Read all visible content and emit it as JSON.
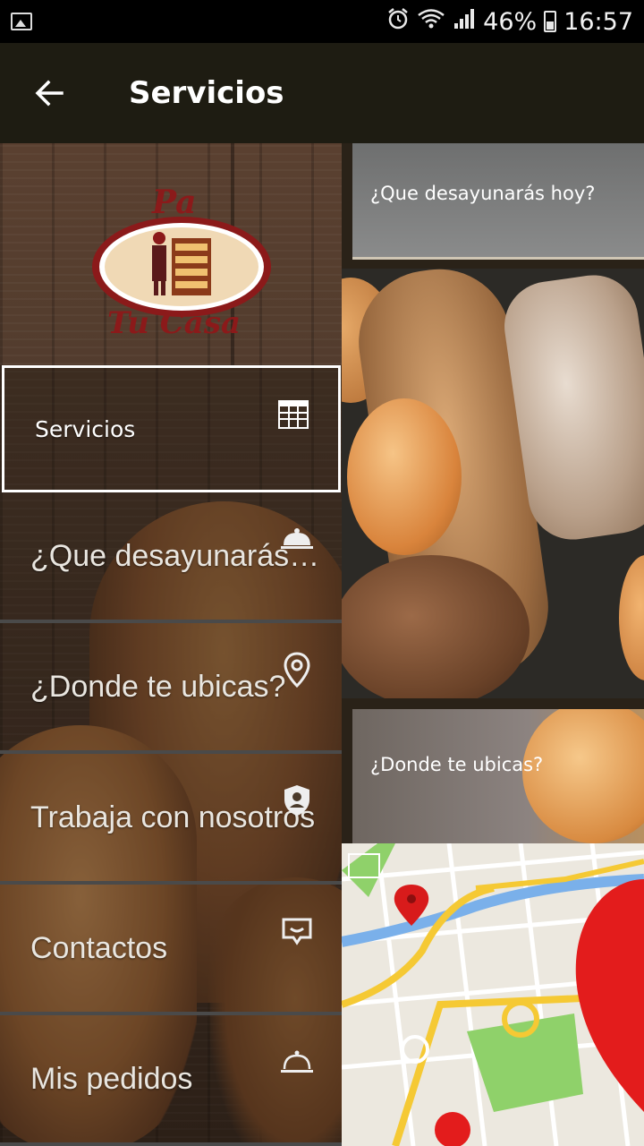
{
  "status_bar": {
    "battery_percent": "46%",
    "time": "16:57",
    "icons": [
      "gallery-icon",
      "alarm-icon",
      "wifi-icon",
      "signal-icon",
      "battery-icon"
    ]
  },
  "app_bar": {
    "title": "Servicios",
    "back_icon": "arrow-back-icon"
  },
  "drawer": {
    "logo": {
      "top_text": "Pa",
      "bottom_text": "Tu Casa"
    },
    "items": [
      {
        "label": "Servicios",
        "icon": "table-icon",
        "selected": true
      },
      {
        "label": "¿Que desayunarás hoy?",
        "icon": "cloche-icon"
      },
      {
        "label": "¿Donde te ubicas?",
        "icon": "location-pin-icon"
      },
      {
        "label": "Trabaja con nosotros",
        "icon": "shield-user-icon"
      },
      {
        "label": "Contactos",
        "icon": "chat-icon"
      },
      {
        "label": "Mis pedidos",
        "icon": "room-service-icon"
      }
    ]
  },
  "content": {
    "cards": [
      {
        "title": "¿Que desayunarás hoy?"
      },
      {
        "title": "¿Donde te ubicas?"
      }
    ]
  },
  "colors": {
    "status_bar": "#000000",
    "app_bar": "#1e1c12",
    "selected_border": "#ffffff",
    "divider": "#4a4a4a",
    "map_pin": "#d81b1b"
  }
}
